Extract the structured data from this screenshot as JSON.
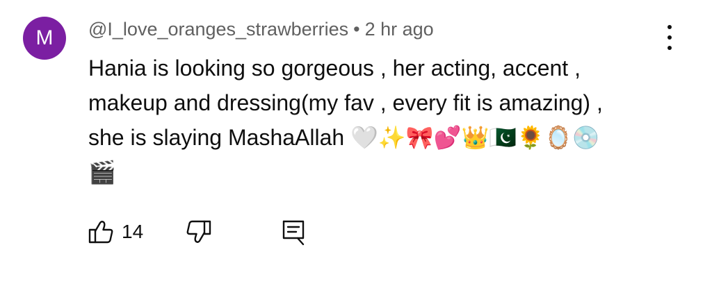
{
  "comment": {
    "avatar_letter": "M",
    "avatar_color": "#7b1fa2",
    "author": "@I_love_oranges_strawberries",
    "separator": "•",
    "time": "2 hr ago",
    "text": "Hania is looking so gorgeous , her acting, accent ,\n makeup and dressing(my fav , every fit is amazing) ,\n she is slaying MashaAllah 🤍✨🎀💕👑🇵🇰🌻🪞💿\n🎬",
    "like_count": "14"
  },
  "icons": {
    "menu": "more-vertical-icon",
    "like": "thumbs-up-icon",
    "dislike": "thumbs-down-icon",
    "reply": "comment-reply-icon"
  }
}
